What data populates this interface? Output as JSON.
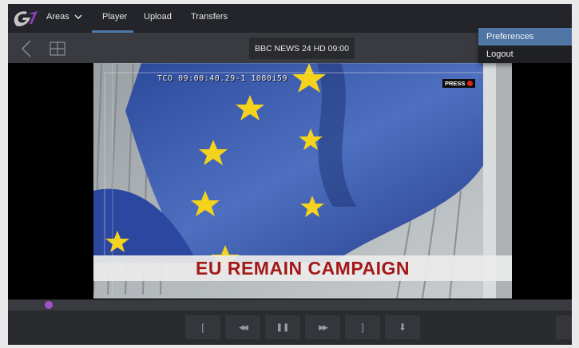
{
  "nav": {
    "areas_label": "Areas",
    "tabs": [
      {
        "label": "Player",
        "active": true
      },
      {
        "label": "Upload",
        "active": false
      },
      {
        "label": "Transfers",
        "active": false
      }
    ]
  },
  "toolbar": {
    "source_label": "BBC NEWS 24 HD 09:00"
  },
  "user_menu": {
    "items": [
      {
        "label": "Preferences",
        "selected": true
      },
      {
        "label": "Logout",
        "selected": false
      }
    ]
  },
  "video": {
    "timecode": "TCO 09:00:40.29-1 1080i59",
    "press_badge": "PRESS",
    "caption": "EU REMAIN CAMPAIGN"
  },
  "transport": {
    "buttons": [
      {
        "name": "mark-in",
        "glyph": "["
      },
      {
        "name": "rewind",
        "glyph": "◀◀"
      },
      {
        "name": "pause",
        "glyph": "❚❚"
      },
      {
        "name": "fast-forward",
        "glyph": "▶▶"
      },
      {
        "name": "mark-out",
        "glyph": "]"
      },
      {
        "name": "download",
        "glyph": "⬇"
      }
    ]
  },
  "colors": {
    "accent": "#4f79a6",
    "menu_selected": "#5076a6",
    "playhead": "#a052c8",
    "caption_red": "#a31818"
  }
}
